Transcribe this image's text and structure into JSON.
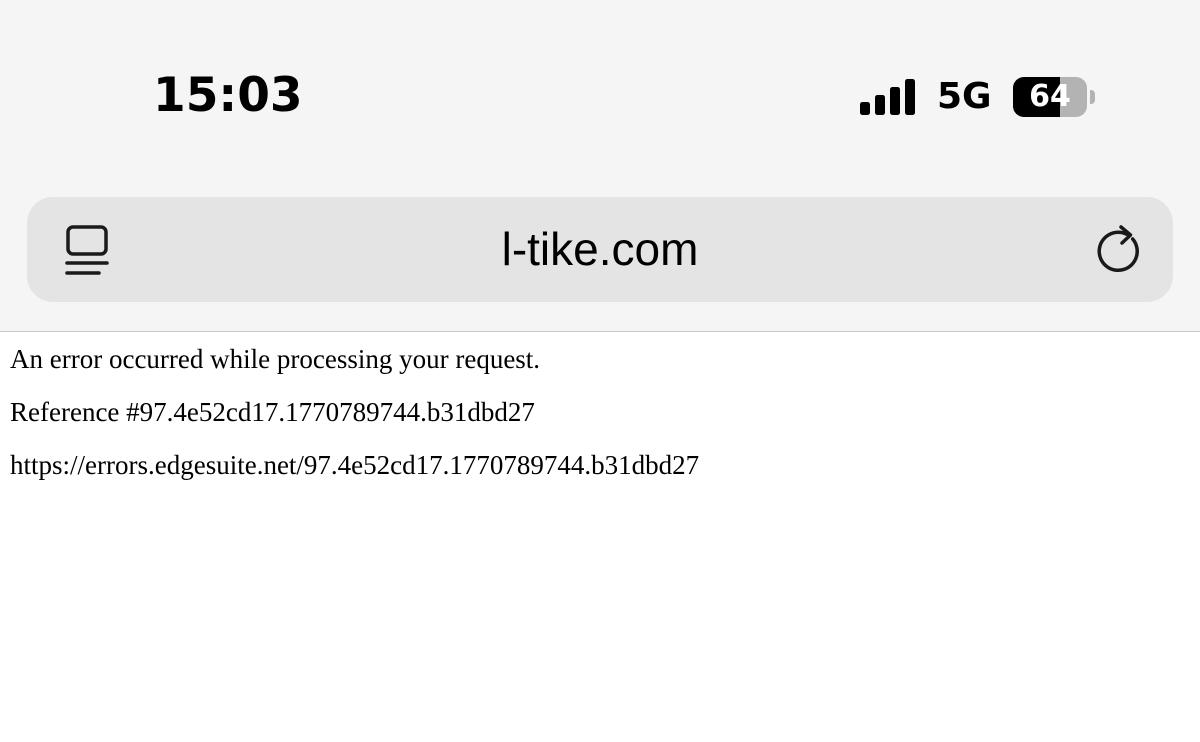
{
  "status_bar": {
    "time": "15:03",
    "network": "5G",
    "battery_level": "64",
    "battery_fraction": 0.64,
    "signal_bars": 4,
    "icons": [
      "cellular-signal-icon",
      "battery-icon"
    ]
  },
  "address_bar": {
    "url": "l-tike.com",
    "icons": [
      "reader-icon",
      "reload-icon"
    ]
  },
  "page": {
    "message": "An error occurred while processing your request.",
    "reference": "Reference #97.4e52cd17.1770789744.b31dbd27",
    "error_url": "https://errors.edgesuite.net/97.4e52cd17.1770789744.b31dbd27"
  },
  "colors": {
    "chrome_background": "#f5f5f5",
    "address_bar_background": "#e4e4e4",
    "page_background": "#ffffff",
    "text": "#000000"
  }
}
